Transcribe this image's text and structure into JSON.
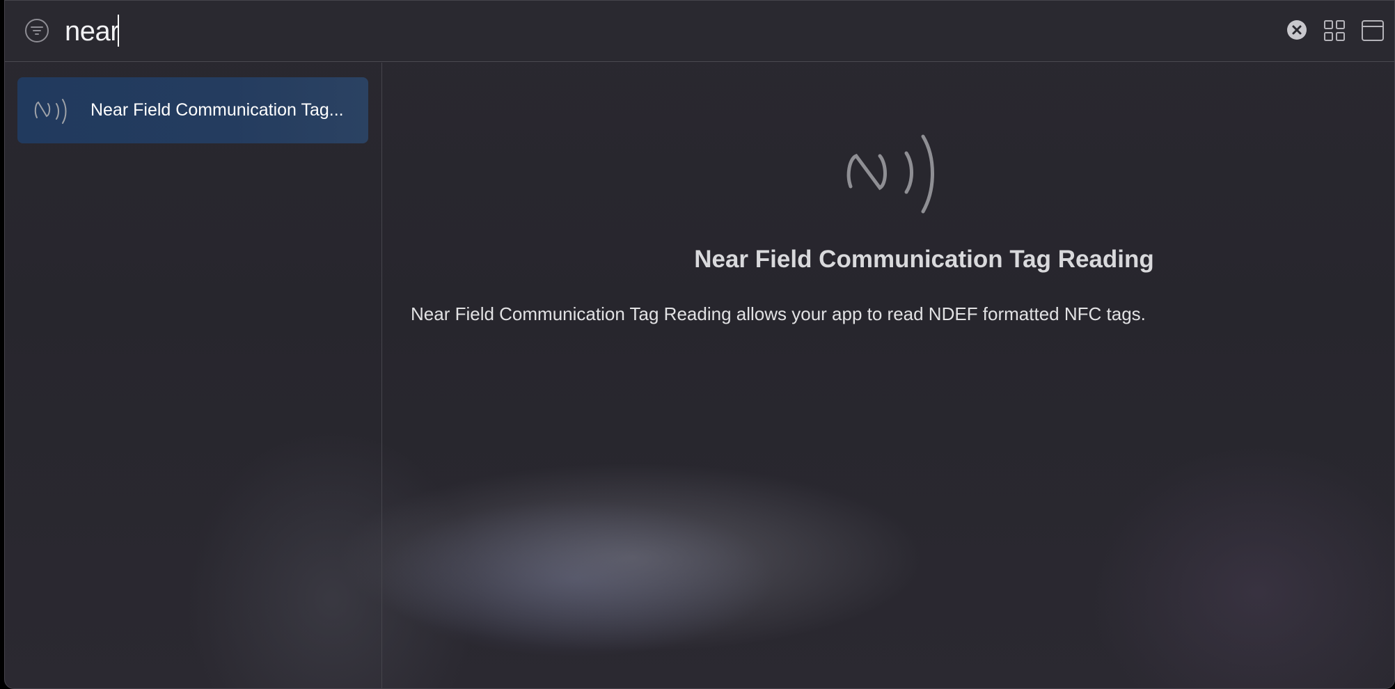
{
  "search": {
    "query": "near",
    "filter_icon": "filter-icon",
    "clear_icon": "clear-circle-icon",
    "grid_icon": "grid-view-icon",
    "window_icon": "window-icon"
  },
  "results": [
    {
      "label": "Near Field Communication Tag...",
      "icon": "nfc-icon",
      "selected": true
    }
  ],
  "detail": {
    "icon": "nfc-icon",
    "title": "Near Field Communication Tag Reading",
    "description": "Near Field Communication Tag Reading allows your app to read NDEF formatted NFC tags."
  },
  "colors": {
    "selection": "#223b5e",
    "background": "#28272e"
  }
}
